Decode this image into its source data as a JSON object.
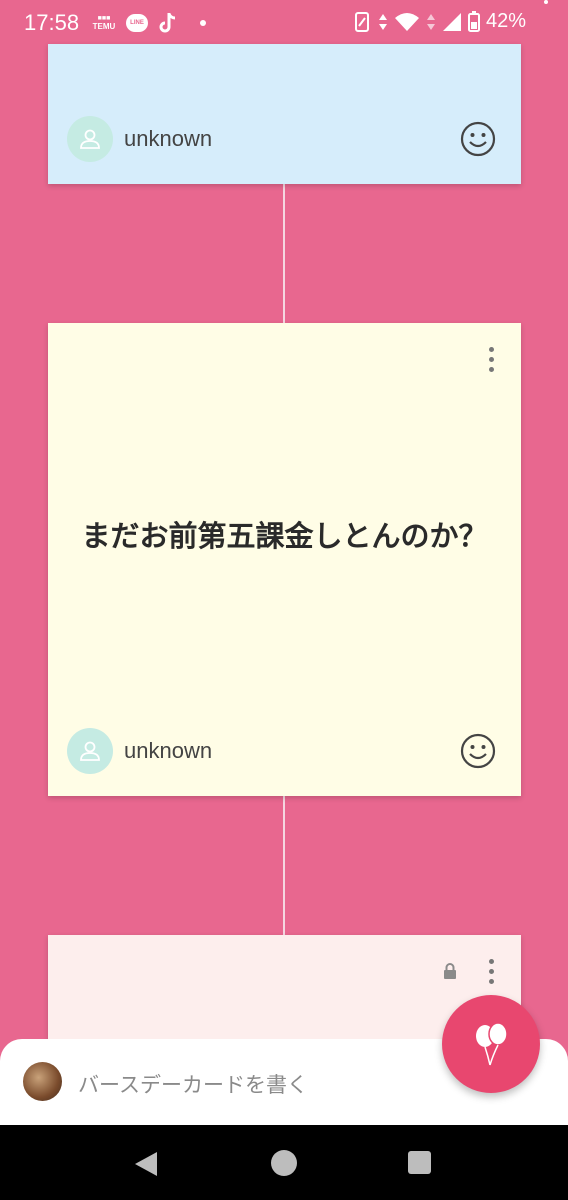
{
  "status_bar": {
    "time": "17:58",
    "apps": [
      "TEMU",
      "LINE",
      "TikTok"
    ],
    "battery_pct": "42%"
  },
  "cards": [
    {
      "color": "#d6edfb",
      "author": "unknown",
      "message": ""
    },
    {
      "color": "#fffde6",
      "author": "unknown",
      "message": "まだお前第五課金しとんのか？"
    },
    {
      "color": "#fdeeed",
      "author": "",
      "message": "",
      "locked": true
    }
  ],
  "composer": {
    "placeholder": "バースデーカードを書く"
  },
  "colors": {
    "background": "#e8678f",
    "fab": "#e8476f"
  }
}
